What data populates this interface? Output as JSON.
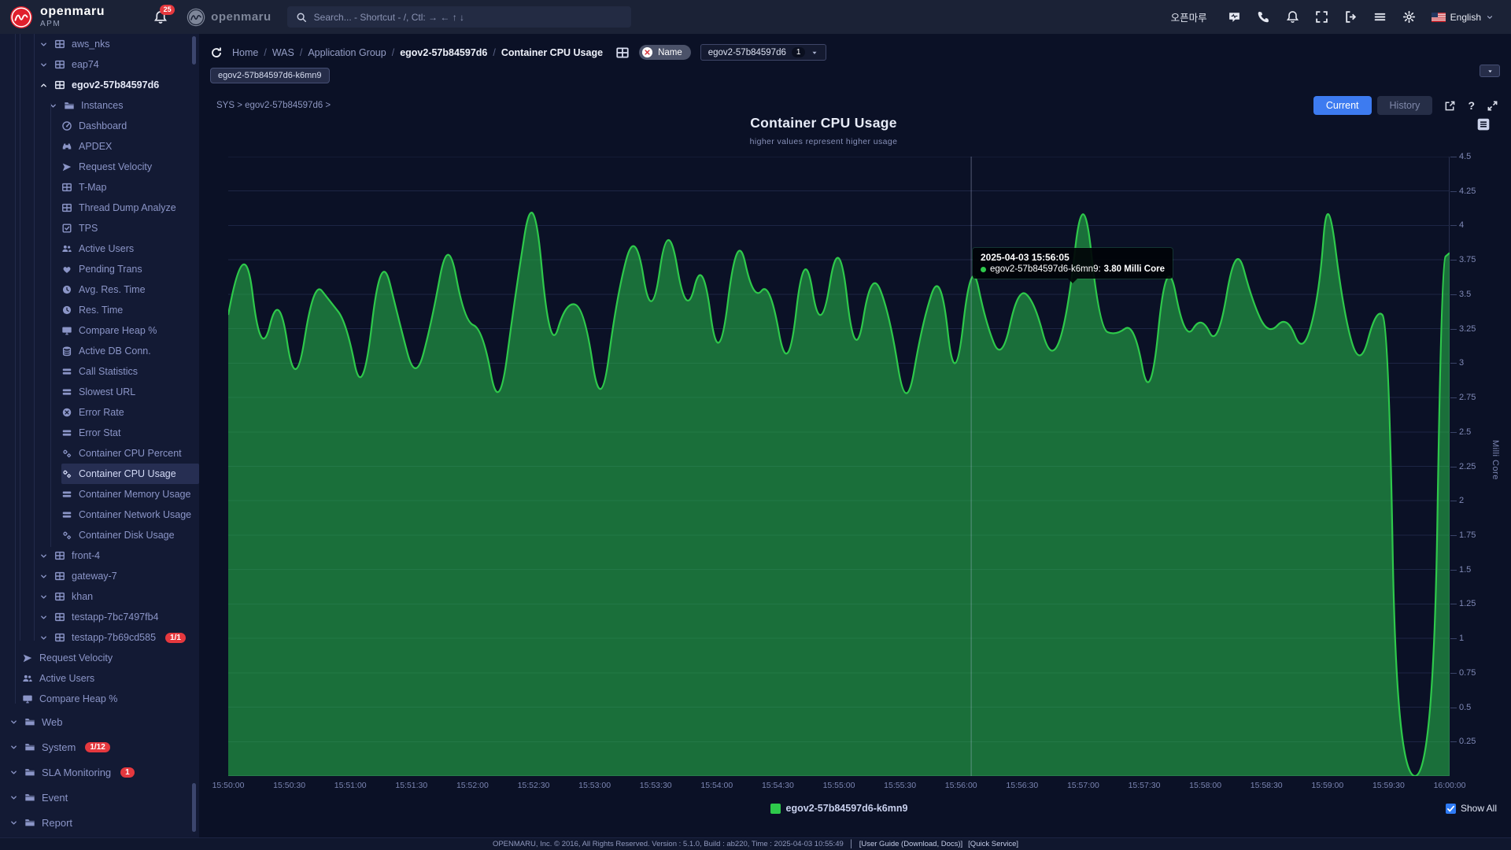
{
  "topbar": {
    "brand": "openmaru",
    "brand_sub": "APM",
    "notification_count": "25",
    "secondary_brand": "openmaru",
    "search_placeholder": "Search... - Shortcut - /, Ctl: → ← ↑ ↓",
    "username": "오픈마루",
    "language": "English"
  },
  "sidebar": {
    "items": [
      {
        "label": "aws_nks",
        "icon": "table",
        "level": 2,
        "chevron": "down"
      },
      {
        "label": "eap74",
        "icon": "table",
        "level": 2,
        "chevron": "down"
      },
      {
        "label": "egov2-57b84597d6",
        "icon": "table",
        "level": 2,
        "chevron": "up",
        "bold": true
      },
      {
        "label": "Instances",
        "icon": "folder",
        "level": 3,
        "chevron": "down"
      },
      {
        "label": "Dashboard",
        "icon": "dashboard",
        "level": 3
      },
      {
        "label": "APDEX",
        "icon": "binoculars",
        "level": 3
      },
      {
        "label": "Request Velocity",
        "icon": "velocity",
        "level": 3
      },
      {
        "label": "T-Map",
        "icon": "table",
        "level": 3
      },
      {
        "label": "Thread Dump Analyze",
        "icon": "table",
        "level": 3
      },
      {
        "label": "TPS",
        "icon": "check-square",
        "level": 3
      },
      {
        "label": "Active Users",
        "icon": "users",
        "level": 3
      },
      {
        "label": "Pending Trans",
        "icon": "heart",
        "level": 3
      },
      {
        "label": "Avg. Res. Time",
        "icon": "clock",
        "level": 3
      },
      {
        "label": "Res. Time",
        "icon": "clock",
        "level": 3
      },
      {
        "label": "Compare Heap %",
        "icon": "monitor",
        "level": 3
      },
      {
        "label": "Active DB Conn.",
        "icon": "database",
        "level": 3
      },
      {
        "label": "Call Statistics",
        "icon": "list",
        "level": 3
      },
      {
        "label": "Slowest URL",
        "icon": "list",
        "level": 3
      },
      {
        "label": "Error Rate",
        "icon": "error",
        "level": 3
      },
      {
        "label": "Error Stat",
        "icon": "list",
        "level": 3
      },
      {
        "label": "Container CPU Percent",
        "icon": "gears",
        "level": 3
      },
      {
        "label": "Container CPU Usage",
        "icon": "gears",
        "level": 3,
        "selected": true
      },
      {
        "label": "Container Memory Usage",
        "icon": "list",
        "level": 3
      },
      {
        "label": "Container Network Usage",
        "icon": "list",
        "level": 3
      },
      {
        "label": "Container Disk Usage",
        "icon": "gears",
        "level": 3
      },
      {
        "label": "front-4",
        "icon": "table",
        "level": 2,
        "chevron": "down"
      },
      {
        "label": "gateway-7",
        "icon": "table",
        "level": 2,
        "chevron": "down"
      },
      {
        "label": "khan",
        "icon": "table",
        "level": 2,
        "chevron": "down"
      },
      {
        "label": "testapp-7bc7497fb4",
        "icon": "table",
        "level": 2,
        "chevron": "down"
      },
      {
        "label": "testapp-7b69cd585",
        "icon": "table",
        "level": 2,
        "chevron": "down",
        "badge": "1/1"
      },
      {
        "label": "Request Velocity",
        "icon": "velocity",
        "level": 1
      },
      {
        "label": "Active Users",
        "icon": "users",
        "level": 1
      },
      {
        "label": "Compare Heap %",
        "icon": "monitor",
        "level": 1
      },
      {
        "label": "Web",
        "icon": "folder",
        "level": 0,
        "chevron": "down"
      },
      {
        "label": "System",
        "icon": "folder",
        "level": 0,
        "chevron": "down",
        "badge": "1/12"
      },
      {
        "label": "SLA Monitoring",
        "icon": "folder",
        "level": 0,
        "chevron": "down",
        "badge": "1"
      },
      {
        "label": "Event",
        "icon": "folder",
        "level": 0,
        "chevron": "down"
      },
      {
        "label": "Report",
        "icon": "folder",
        "level": 0,
        "chevron": "down"
      }
    ]
  },
  "breadcrumb": {
    "items": [
      "Home",
      "WAS",
      "Application Group",
      "egov2-57b84597d6",
      "Container CPU Usage"
    ]
  },
  "filter": {
    "tag_label": "Name",
    "selected_value": "egov2-57b84597d6",
    "selected_count": "1",
    "instance_chip": "egov2-57b84597d6-k6mn9"
  },
  "panel": {
    "scope_path": "SYS > egov2-57b84597d6 >",
    "current_label": "Current",
    "history_label": "History",
    "show_all_label": "Show All",
    "tooltip": {
      "time": "2025-04-03 15:56:05",
      "series_label": "egov2-57b84597d6-k6mn9:",
      "value": "3.80 Milli Core"
    }
  },
  "chart_data": {
    "type": "area",
    "title": "Container CPU Usage",
    "subtitle": "higher values represent higher usage",
    "ylabel": "Milli Core",
    "ylim": [
      0,
      4.5
    ],
    "grid": true,
    "legend_position": "bottom",
    "series": [
      {
        "name": "egov2-57b84597d6-k6mn9",
        "color": "#2ec94b"
      }
    ],
    "xticks": [
      "15:50:00",
      "15:50:30",
      "15:51:00",
      "15:51:30",
      "15:52:00",
      "15:52:30",
      "15:53:00",
      "15:53:30",
      "15:54:00",
      "15:54:30",
      "15:55:00",
      "15:55:30",
      "15:56:00",
      "15:56:30",
      "15:57:00",
      "15:57:30",
      "15:58:00",
      "15:58:30",
      "15:59:00",
      "15:59:30",
      "16:00:00"
    ],
    "yticks": [
      "4.5",
      "4.25",
      "4",
      "3.75",
      "3.5",
      "3.25",
      "3",
      "2.75",
      "2.5",
      "2.25",
      "2",
      "1.75",
      "1.5",
      "1.25",
      "1",
      "0.75",
      "0.5",
      "0.25"
    ],
    "x_domain_seconds": 600,
    "crosshair_t": 365,
    "points": [
      [
        0,
        3.35
      ],
      [
        8,
        4.0
      ],
      [
        16,
        3.0
      ],
      [
        25,
        3.55
      ],
      [
        33,
        2.75
      ],
      [
        42,
        3.6
      ],
      [
        50,
        3.45
      ],
      [
        58,
        3.3
      ],
      [
        66,
        2.7
      ],
      [
        75,
        3.85
      ],
      [
        84,
        3.3
      ],
      [
        92,
        2.85
      ],
      [
        100,
        3.3
      ],
      [
        108,
        3.95
      ],
      [
        116,
        3.3
      ],
      [
        125,
        3.25
      ],
      [
        133,
        2.6
      ],
      [
        141,
        3.5
      ],
      [
        150,
        4.35
      ],
      [
        158,
        3.05
      ],
      [
        166,
        3.45
      ],
      [
        175,
        3.4
      ],
      [
        183,
        2.6
      ],
      [
        191,
        3.5
      ],
      [
        200,
        4.0
      ],
      [
        208,
        3.25
      ],
      [
        216,
        4.1
      ],
      [
        225,
        3.3
      ],
      [
        233,
        3.8
      ],
      [
        241,
        2.9
      ],
      [
        250,
        4.0
      ],
      [
        258,
        3.45
      ],
      [
        266,
        3.6
      ],
      [
        275,
        2.85
      ],
      [
        283,
        3.9
      ],
      [
        291,
        3.15
      ],
      [
        300,
        4.0
      ],
      [
        308,
        2.95
      ],
      [
        316,
        3.7
      ],
      [
        325,
        3.35
      ],
      [
        333,
        2.6
      ],
      [
        341,
        3.3
      ],
      [
        350,
        3.7
      ],
      [
        357,
        2.75
      ],
      [
        365,
        3.8
      ],
      [
        372,
        3.3
      ],
      [
        380,
        3.0
      ],
      [
        388,
        3.55
      ],
      [
        396,
        3.45
      ],
      [
        404,
        3.0
      ],
      [
        412,
        3.3
      ],
      [
        420,
        4.35
      ],
      [
        428,
        3.25
      ],
      [
        436,
        3.2
      ],
      [
        445,
        3.3
      ],
      [
        453,
        2.65
      ],
      [
        461,
        3.85
      ],
      [
        470,
        3.15
      ],
      [
        478,
        3.35
      ],
      [
        486,
        3.1
      ],
      [
        495,
        3.9
      ],
      [
        503,
        3.45
      ],
      [
        511,
        3.2
      ],
      [
        520,
        3.35
      ],
      [
        528,
        3.05
      ],
      [
        536,
        3.5
      ],
      [
        540,
        4.3
      ],
      [
        548,
        3.35
      ],
      [
        556,
        2.95
      ],
      [
        564,
        3.4
      ],
      [
        570,
        3.3
      ],
      [
        574,
        0
      ],
      [
        592,
        0
      ],
      [
        596,
        3.75
      ],
      [
        600,
        3.8
      ]
    ]
  },
  "colors": {
    "accent_blue": "#3d7bf0",
    "series_green": "#2ec94b",
    "badge_red": "#e5383e"
  },
  "footer": {
    "info": "OPENMARU, Inc. © 2016, All Rights Reserved.  Version : 5.1.0, Build : ab220, Time : 2025-04-03 10:55:49",
    "links": [
      "[User Guide (Download, Docs)]",
      "[Quick Service]"
    ]
  }
}
